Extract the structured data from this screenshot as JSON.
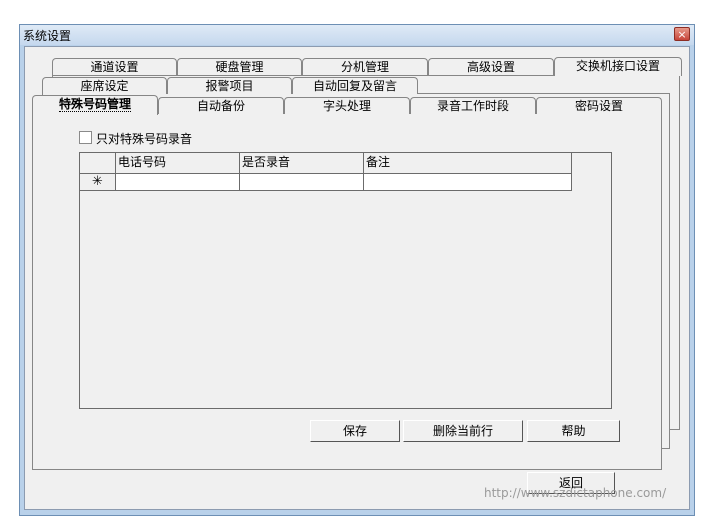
{
  "window": {
    "title": "系统设置",
    "close_symbol": "×"
  },
  "tabs": {
    "row1": [
      "通道设置",
      "硬盘管理",
      "分机管理",
      "高级设置",
      "交换机接口设置"
    ],
    "row2": [
      "座席设定",
      "报警项目",
      "自动回复及留言"
    ],
    "row3": [
      "特殊号码管理",
      "自动备份",
      "字头处理",
      "录音工作时段",
      "密码设置"
    ],
    "active": "特殊号码管理"
  },
  "options": {
    "only_special_label": "只对特殊号码录音",
    "only_special_checked": false
  },
  "grid": {
    "columns": [
      "电话号码",
      "是否录音",
      "备注"
    ],
    "new_row_marker": "✳",
    "rows": []
  },
  "buttons": {
    "save": "保存",
    "delete_row": "删除当前行",
    "help": "帮助",
    "back": "返回"
  },
  "watermark": "http://www.szdictaphone.com/"
}
